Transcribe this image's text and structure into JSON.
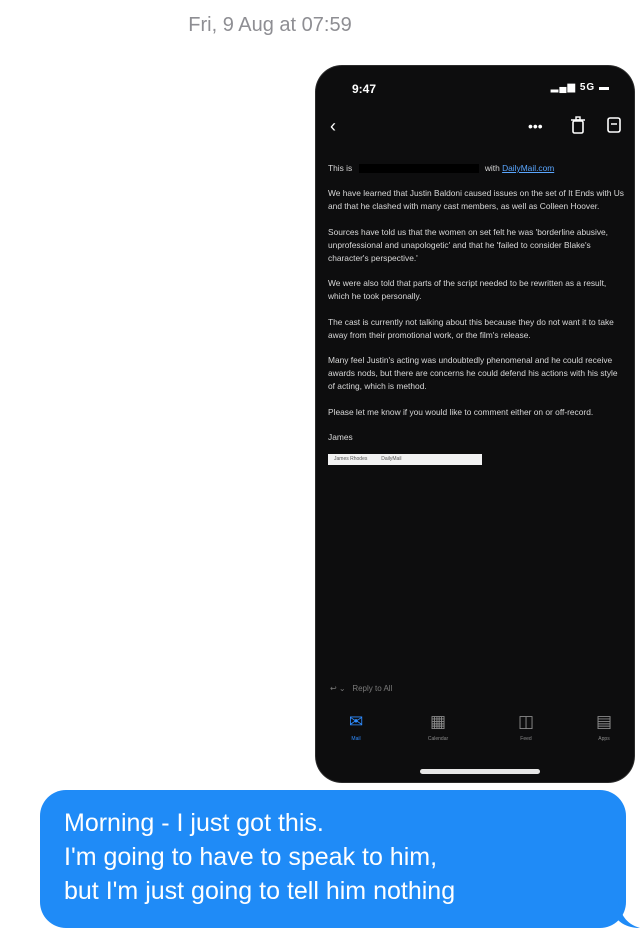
{
  "conversation": {
    "timestamp": "Fri, 9 Aug at 07:59"
  },
  "screenshot": {
    "status_bar": {
      "time": "9:47",
      "indicators": "5G"
    },
    "email": {
      "greeting_before": "This is",
      "greeting_after": "with",
      "publication_link": "DailyMail.com",
      "paragraphs": [
        "We have learned that Justin Baldoni caused issues on the set of It Ends with Us and that he clashed with many cast members, as well as Colleen Hoover.",
        "Sources have told us that the women on set felt he was 'borderline abusive, unprofessional and unapologetic' and that he 'failed to consider Blake's character's perspective.'",
        "We were also told that parts of the script needed to be rewritten as a result, which he took personally.",
        "The cast is currently not talking about this because they do not want it to take away from their promotional work, or the film's release.",
        "Many feel Justin's acting was undoubtedly phenomenal and he could receive awards nods, but there are concerns he could defend his actions with his style of acting, which is method.",
        "Please let me know if you would like to comment either on or off-record."
      ],
      "signoff": "James",
      "signature_left": "James Rhodes",
      "signature_right": "DailyMail",
      "reply_prompt": "Reply to All"
    },
    "tabs": [
      {
        "label": "Mail",
        "icon": "mail-icon"
      },
      {
        "label": "Calendar",
        "icon": "calendar-icon"
      },
      {
        "label": "Feed",
        "icon": "feed-icon"
      },
      {
        "label": "Apps",
        "icon": "apps-icon"
      }
    ]
  },
  "message": {
    "lines": [
      "Morning - I just got this.",
      "I'm going to have to speak to him,",
      "but I'm just going to tell him nothing"
    ]
  },
  "colors": {
    "bubble": "#1f8bf7",
    "phone_bg": "#0d0d0e",
    "accent": "#2f8cff"
  }
}
